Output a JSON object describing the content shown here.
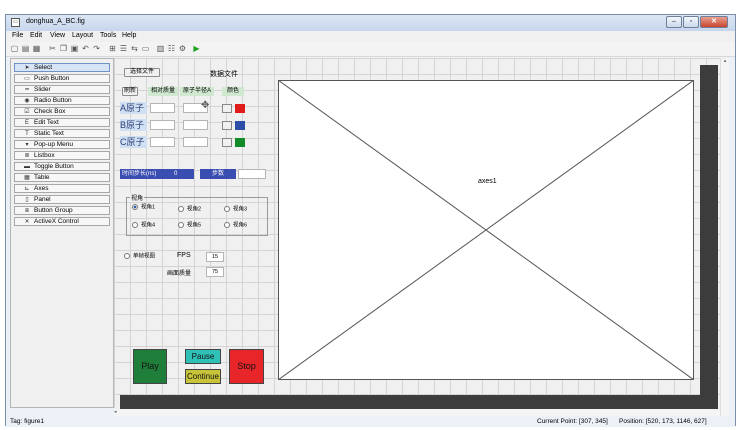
{
  "window": {
    "title": "donghua_A_BC.fig"
  },
  "menu": [
    "File",
    "Edit",
    "View",
    "Layout",
    "Tools",
    "Help"
  ],
  "palette": {
    "select": "Select",
    "items": [
      "Push Button",
      "Slider",
      "Radio Button",
      "Check Box",
      "Edit Text",
      "Static Text",
      "Pop-up Menu",
      "Listbox",
      "Toggle Button",
      "Table",
      "Axes",
      "Panel",
      "Button Group",
      "ActiveX Control"
    ]
  },
  "form": {
    "select_file": "选择文件",
    "data_file": "数据文件",
    "refresh": "刷新",
    "col_mass": "相对质量",
    "col_radius": "原子半径A",
    "col_color": "颜色",
    "atoms": [
      "A原子",
      "B原子",
      "C原子"
    ],
    "atom_colors": [
      "#e01b1b",
      "#2b4fa8",
      "#138a2a"
    ],
    "time_step_label": "时间步长(ns)",
    "time_step_value": "0",
    "step_label": "步数",
    "view_title": "视角",
    "views": [
      "视角1",
      "视角2",
      "视角3",
      "视角4",
      "视角5",
      "视角6"
    ],
    "single_view": "单帧视图",
    "fps_label": "FPS",
    "fps_value": "15",
    "quality_label": "画面质量",
    "quality_value": "75",
    "play": "Play",
    "pause": "Pause",
    "continue": "Continue",
    "stop": "Stop",
    "axes_label": "axes1"
  },
  "status": {
    "tag": "Tag: figure1",
    "current_point": "Current Point:  [307, 345]",
    "position": "Position: [520, 173, 1146, 627]"
  }
}
